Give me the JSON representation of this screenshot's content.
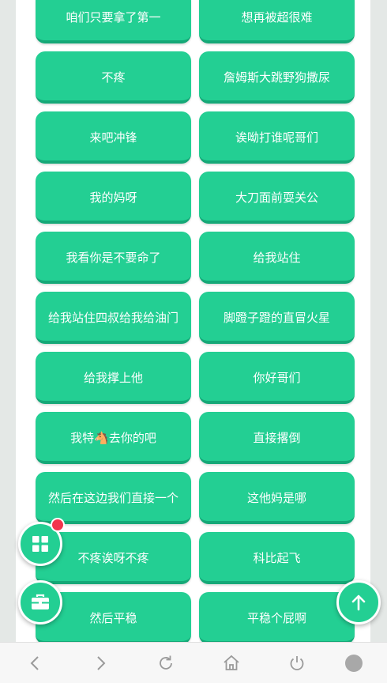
{
  "buttons": [
    {
      "label": "咱们只要拿了第一",
      "name": "sound-button-1"
    },
    {
      "label": "想再被超很难",
      "name": "sound-button-2"
    },
    {
      "label": "不疼",
      "name": "sound-button-3"
    },
    {
      "label": "詹姆斯大跳野狗撒尿",
      "name": "sound-button-4"
    },
    {
      "label": "来吧冲锋",
      "name": "sound-button-5"
    },
    {
      "label": "诶呦打谁呢哥们",
      "name": "sound-button-6"
    },
    {
      "label": "我的妈呀",
      "name": "sound-button-7"
    },
    {
      "label": "大刀面前耍关公",
      "name": "sound-button-8"
    },
    {
      "label": "我看你是不要命了",
      "name": "sound-button-9"
    },
    {
      "label": "给我站住",
      "name": "sound-button-10"
    },
    {
      "label": "给我站住四叔给我给油门",
      "name": "sound-button-11"
    },
    {
      "label": "脚蹬子蹬的直冒火星",
      "name": "sound-button-12"
    },
    {
      "label": "给我撑上他",
      "name": "sound-button-13"
    },
    {
      "label": "你好哥们",
      "name": "sound-button-14"
    },
    {
      "label": "我特🐴去你的吧",
      "name": "sound-button-15"
    },
    {
      "label": "直接撂倒",
      "name": "sound-button-16"
    },
    {
      "label": "然后在这边我们直接一个",
      "name": "sound-button-17"
    },
    {
      "label": "这他妈是哪",
      "name": "sound-button-18"
    },
    {
      "label": "不疼诶呀不疼",
      "name": "sound-button-19"
    },
    {
      "label": "科比起飞",
      "name": "sound-button-20"
    },
    {
      "label": "然后平稳",
      "name": "sound-button-21"
    },
    {
      "label": "平稳个屁啊",
      "name": "sound-button-22"
    }
  ],
  "colors": {
    "accent": "#23cf93",
    "accent_dark": "#15a877",
    "badge": "#f2354d"
  },
  "fabs": {
    "menu_icon": "grid-icon",
    "toolbox_icon": "briefcase-icon",
    "top_icon": "arrow-up-icon"
  },
  "nav": [
    "back-icon",
    "forward-icon",
    "refresh-icon",
    "home-icon",
    "power-icon",
    "profile-icon"
  ]
}
